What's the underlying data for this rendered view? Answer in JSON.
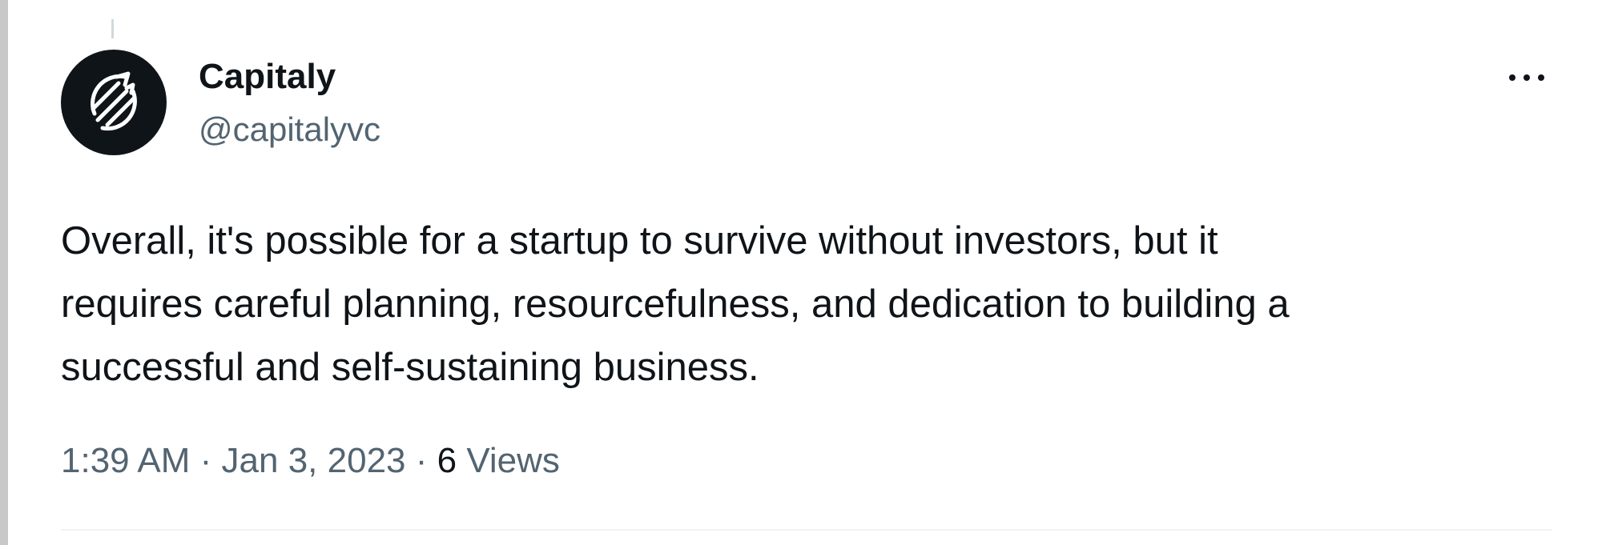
{
  "tweet": {
    "display_name": "Capitaly",
    "handle": "@capitalyvc",
    "avatar_icon": "capitaly-logo-icon",
    "more_icon": "more-options-icon",
    "text": "Overall, it's possible for a startup to survive without investors, but it\nrequires careful planning, resourcefulness, and dedication to building a\nsuccessful and self-sustaining business.",
    "time": "1:39 AM",
    "separator": " · ",
    "date": "Jan 3, 2023",
    "views_count": "6",
    "views_label": " Views"
  },
  "colors": {
    "text_primary": "#0f1419",
    "text_secondary": "#536471",
    "avatar_background": "#0f1419",
    "divider": "#eff3f4"
  }
}
